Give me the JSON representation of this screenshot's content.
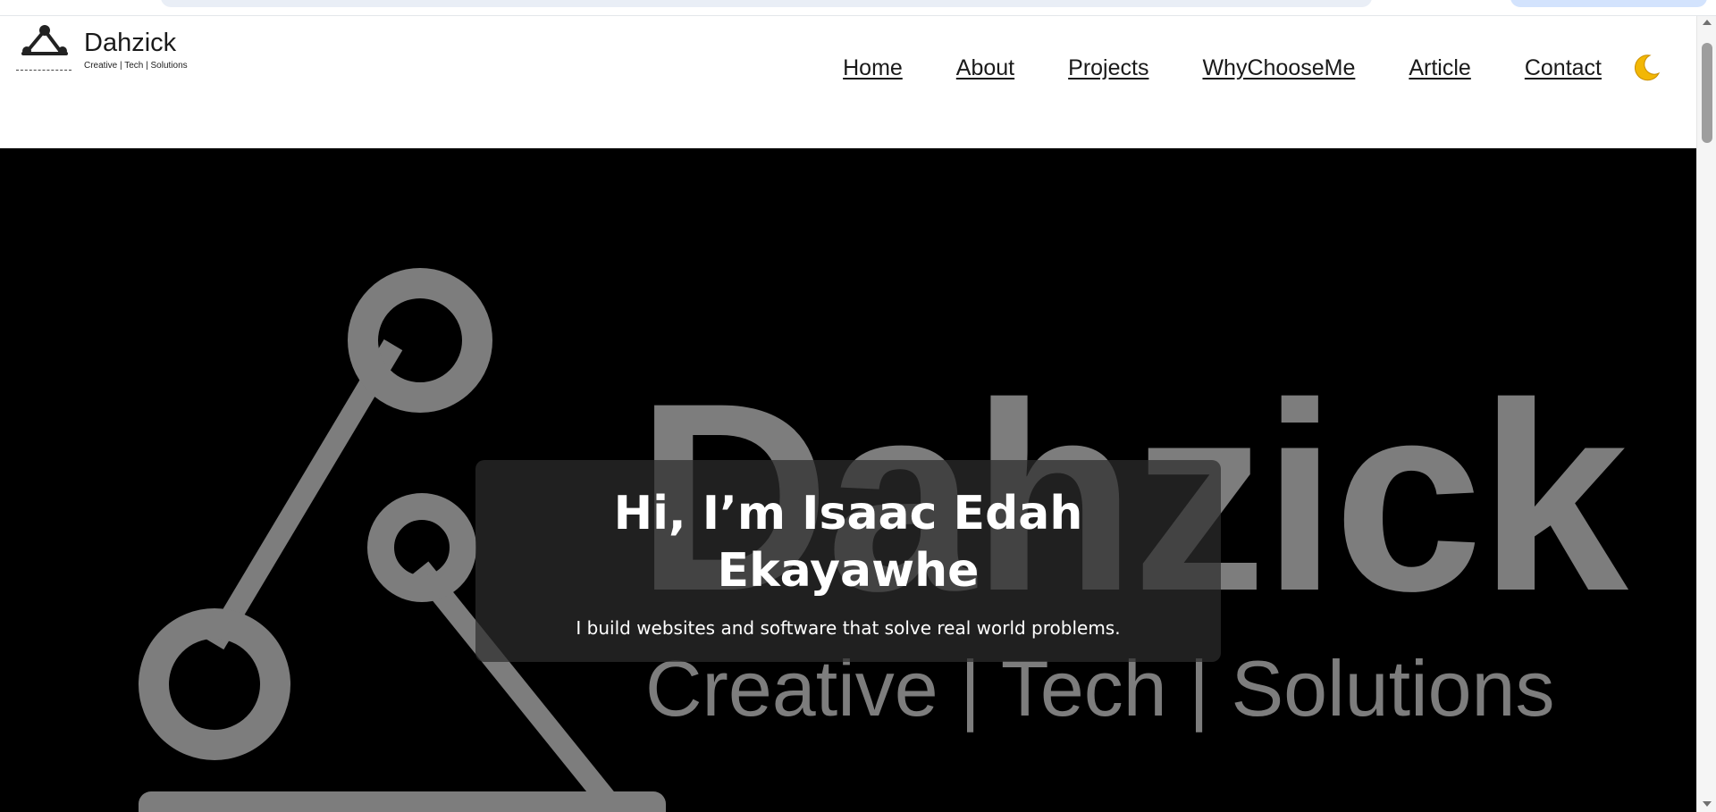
{
  "brand": {
    "name": "Dahzick",
    "tagline": "Creative | Tech | Solutions"
  },
  "nav": {
    "items": [
      {
        "label": "Home"
      },
      {
        "label": "About"
      },
      {
        "label": "Projects"
      },
      {
        "label": "WhyChooseMe"
      },
      {
        "label": "Article"
      },
      {
        "label": "Contact"
      }
    ],
    "theme_icon": "moon-icon"
  },
  "hero": {
    "title": "Hi, I’m Isaac Edah Ekayawhe",
    "subtitle": "I build websites and software that solve real world problems.",
    "watermark_word": "Dahzick",
    "watermark_tagline": "Creative | Tech | Solutions"
  },
  "colors": {
    "hero_bg": "#000000",
    "watermark": "#7d7d7d",
    "card_bg": "#2d2d2d",
    "moon": "#f2b705"
  }
}
